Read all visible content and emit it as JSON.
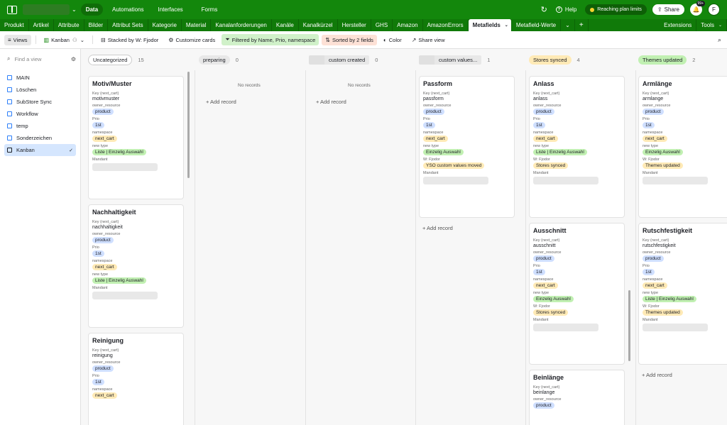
{
  "topbar": {
    "nav": [
      "Data",
      "Automations",
      "Interfaces",
      "Forms"
    ],
    "help": "Help",
    "plan": "Reaching plan limits",
    "share": "Share",
    "badge": "99+",
    "avatar": "F"
  },
  "tables": [
    "Produkt",
    "Artikel",
    "Attribute",
    "Bilder",
    "Attribut Sets",
    "Kategorie",
    "Material",
    "Kanalanforderungen",
    "Kanäle",
    "Kanalkürzel",
    "Hersteller",
    "GHS",
    "Amazon",
    "AmazonErrors",
    "Metafields",
    "Metafield-Werte"
  ],
  "tables_right": [
    "Extensions",
    "Tools"
  ],
  "toolbar": {
    "views": "Views",
    "kanban": "Kanban",
    "stacked": "Stacked by W: Fjodor",
    "customize": "Customize cards",
    "filter": "Filtered by Name, Prio, namespace",
    "sort": "Sorted by 2 fields",
    "color": "Color",
    "share": "Share view"
  },
  "sidebar": {
    "find": "Find a view",
    "items": [
      "MAIN",
      "Löschen",
      "SubStore Sync",
      "Workflow",
      "temp",
      "Sonderzeichen",
      "Kanban"
    ]
  },
  "labels": {
    "key": "Key (next_cart)",
    "owner": "owner_resource",
    "prio": "Prio",
    "ns": "namespace",
    "type": "new type",
    "wf": "W: Fjodor",
    "mand": "Mandant",
    "norec": "No records",
    "add": "+ Add record"
  },
  "columns": [
    {
      "name": "Uncategorized",
      "count": "15",
      "color": "#ffffff"
    },
    {
      "name": "preparing",
      "count": "0",
      "color": "#e8e8e8"
    },
    {
      "name": "custom created",
      "count": "0",
      "color": "#e8e8e8"
    },
    {
      "name": "custom values...",
      "count": "1",
      "color": "#e8e8e8"
    },
    {
      "name": "Stores synced",
      "count": "4",
      "color": "#ffeab6"
    },
    {
      "name": "Themes updated",
      "count": "2",
      "color": "#c1f0b2"
    }
  ],
  "cards": {
    "c0": [
      {
        "title": "Motiv/Muster",
        "key": "motivmuster",
        "owner": "product",
        "prio": "1st",
        "ns": "next_cart",
        "type": "Liste | Einzelig Auswahl"
      },
      {
        "title": "Nachhaltigkeit",
        "key": "nachhaltigkeit",
        "owner": "product",
        "prio": "1st",
        "ns": "next_cart",
        "type": "Liste | Einzelig Auswahl"
      },
      {
        "title": "Reinigung",
        "key": "reinigung",
        "owner": "product",
        "prio": "1st",
        "ns": "next_cart"
      }
    ],
    "c3": [
      {
        "title": "Passform",
        "key": "passform",
        "owner": "product",
        "prio": "1st",
        "ns": "next_cart",
        "type": "Einzelig Auswahl",
        "wf": "YSO custom values moved"
      }
    ],
    "c4": [
      {
        "title": "Anlass",
        "key": "anlass",
        "owner": "product",
        "prio": "1st",
        "ns": "next_cart",
        "type": "Liste | Einzelig Auswahl",
        "wf": "Stores synced"
      },
      {
        "title": "Ausschnitt",
        "key": "ausschnitt",
        "owner": "product",
        "prio": "1st",
        "ns": "next_cart",
        "type": "Einzelig Auswahl",
        "wf": "Stores synced"
      },
      {
        "title": "Beinlänge",
        "key": "beinlange",
        "owner": "product"
      }
    ],
    "c5": [
      {
        "title": "Armlänge",
        "key": "armlange",
        "owner": "product",
        "prio": "1st",
        "ns": "next_cart",
        "type": "Einzelig Auswahl",
        "wf": "Themes updated"
      },
      {
        "title": "Rutschfestigkeit",
        "key": "rutschfestigkeit",
        "owner": "product",
        "prio": "1st",
        "ns": "next_cart",
        "type": "Liste | Einzelig Auswahl",
        "wf": "Themes updated"
      }
    ]
  }
}
